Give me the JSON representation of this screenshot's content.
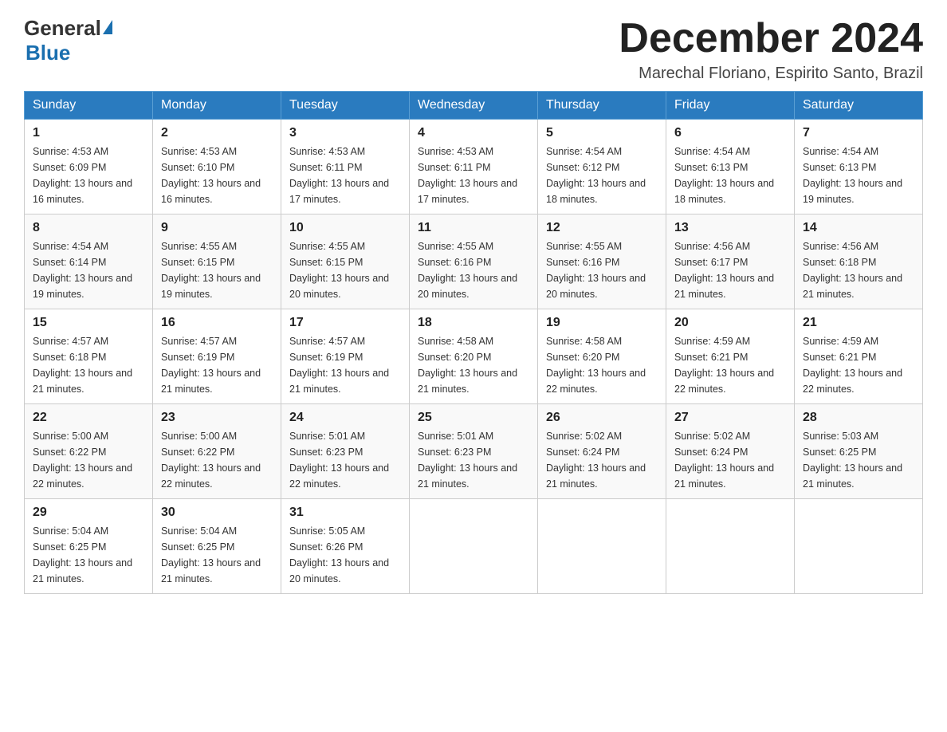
{
  "logo": {
    "general": "General",
    "blue": "Blue"
  },
  "header": {
    "title": "December 2024",
    "location": "Marechal Floriano, Espirito Santo, Brazil"
  },
  "weekdays": [
    "Sunday",
    "Monday",
    "Tuesday",
    "Wednesday",
    "Thursday",
    "Friday",
    "Saturday"
  ],
  "weeks": [
    [
      {
        "day": "1",
        "sunrise": "4:53 AM",
        "sunset": "6:09 PM",
        "daylight": "13 hours and 16 minutes."
      },
      {
        "day": "2",
        "sunrise": "4:53 AM",
        "sunset": "6:10 PM",
        "daylight": "13 hours and 16 minutes."
      },
      {
        "day": "3",
        "sunrise": "4:53 AM",
        "sunset": "6:11 PM",
        "daylight": "13 hours and 17 minutes."
      },
      {
        "day": "4",
        "sunrise": "4:53 AM",
        "sunset": "6:11 PM",
        "daylight": "13 hours and 17 minutes."
      },
      {
        "day": "5",
        "sunrise": "4:54 AM",
        "sunset": "6:12 PM",
        "daylight": "13 hours and 18 minutes."
      },
      {
        "day": "6",
        "sunrise": "4:54 AM",
        "sunset": "6:13 PM",
        "daylight": "13 hours and 18 minutes."
      },
      {
        "day": "7",
        "sunrise": "4:54 AM",
        "sunset": "6:13 PM",
        "daylight": "13 hours and 19 minutes."
      }
    ],
    [
      {
        "day": "8",
        "sunrise": "4:54 AM",
        "sunset": "6:14 PM",
        "daylight": "13 hours and 19 minutes."
      },
      {
        "day": "9",
        "sunrise": "4:55 AM",
        "sunset": "6:15 PM",
        "daylight": "13 hours and 19 minutes."
      },
      {
        "day": "10",
        "sunrise": "4:55 AM",
        "sunset": "6:15 PM",
        "daylight": "13 hours and 20 minutes."
      },
      {
        "day": "11",
        "sunrise": "4:55 AM",
        "sunset": "6:16 PM",
        "daylight": "13 hours and 20 minutes."
      },
      {
        "day": "12",
        "sunrise": "4:55 AM",
        "sunset": "6:16 PM",
        "daylight": "13 hours and 20 minutes."
      },
      {
        "day": "13",
        "sunrise": "4:56 AM",
        "sunset": "6:17 PM",
        "daylight": "13 hours and 21 minutes."
      },
      {
        "day": "14",
        "sunrise": "4:56 AM",
        "sunset": "6:18 PM",
        "daylight": "13 hours and 21 minutes."
      }
    ],
    [
      {
        "day": "15",
        "sunrise": "4:57 AM",
        "sunset": "6:18 PM",
        "daylight": "13 hours and 21 minutes."
      },
      {
        "day": "16",
        "sunrise": "4:57 AM",
        "sunset": "6:19 PM",
        "daylight": "13 hours and 21 minutes."
      },
      {
        "day": "17",
        "sunrise": "4:57 AM",
        "sunset": "6:19 PM",
        "daylight": "13 hours and 21 minutes."
      },
      {
        "day": "18",
        "sunrise": "4:58 AM",
        "sunset": "6:20 PM",
        "daylight": "13 hours and 21 minutes."
      },
      {
        "day": "19",
        "sunrise": "4:58 AM",
        "sunset": "6:20 PM",
        "daylight": "13 hours and 22 minutes."
      },
      {
        "day": "20",
        "sunrise": "4:59 AM",
        "sunset": "6:21 PM",
        "daylight": "13 hours and 22 minutes."
      },
      {
        "day": "21",
        "sunrise": "4:59 AM",
        "sunset": "6:21 PM",
        "daylight": "13 hours and 22 minutes."
      }
    ],
    [
      {
        "day": "22",
        "sunrise": "5:00 AM",
        "sunset": "6:22 PM",
        "daylight": "13 hours and 22 minutes."
      },
      {
        "day": "23",
        "sunrise": "5:00 AM",
        "sunset": "6:22 PM",
        "daylight": "13 hours and 22 minutes."
      },
      {
        "day": "24",
        "sunrise": "5:01 AM",
        "sunset": "6:23 PM",
        "daylight": "13 hours and 22 minutes."
      },
      {
        "day": "25",
        "sunrise": "5:01 AM",
        "sunset": "6:23 PM",
        "daylight": "13 hours and 21 minutes."
      },
      {
        "day": "26",
        "sunrise": "5:02 AM",
        "sunset": "6:24 PM",
        "daylight": "13 hours and 21 minutes."
      },
      {
        "day": "27",
        "sunrise": "5:02 AM",
        "sunset": "6:24 PM",
        "daylight": "13 hours and 21 minutes."
      },
      {
        "day": "28",
        "sunrise": "5:03 AM",
        "sunset": "6:25 PM",
        "daylight": "13 hours and 21 minutes."
      }
    ],
    [
      {
        "day": "29",
        "sunrise": "5:04 AM",
        "sunset": "6:25 PM",
        "daylight": "13 hours and 21 minutes."
      },
      {
        "day": "30",
        "sunrise": "5:04 AM",
        "sunset": "6:25 PM",
        "daylight": "13 hours and 21 minutes."
      },
      {
        "day": "31",
        "sunrise": "5:05 AM",
        "sunset": "6:26 PM",
        "daylight": "13 hours and 20 minutes."
      },
      null,
      null,
      null,
      null
    ]
  ]
}
